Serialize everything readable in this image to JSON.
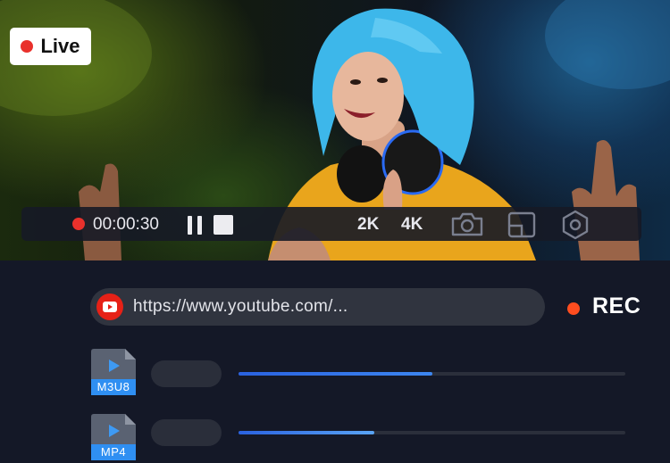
{
  "video": {
    "live_label": "Live",
    "timer": "00:00:30",
    "quality_options": [
      "2K",
      "4K"
    ],
    "icons": [
      "pause-icon",
      "stop-icon",
      "camera-icon",
      "crop-icon",
      "settings-icon"
    ]
  },
  "recorder": {
    "url_value": "https://www.youtube.com/...",
    "rec_label": "REC",
    "accent": "#e9312c",
    "files": [
      {
        "format": "M3U8",
        "progress": 0.5
      },
      {
        "format": "MP4",
        "progress": 0.35
      }
    ]
  }
}
